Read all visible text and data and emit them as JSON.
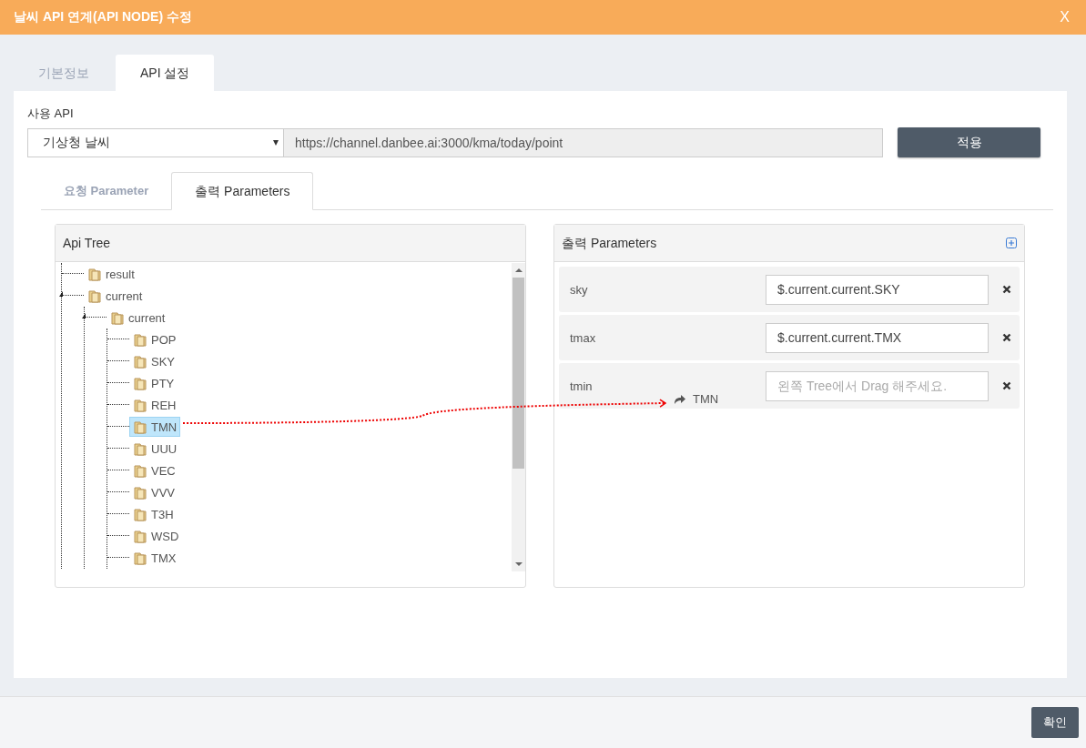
{
  "window": {
    "title": "날씨 API 연계(API NODE) 수정",
    "close": "X"
  },
  "tabs": [
    {
      "label": "기본정보",
      "selected": false
    },
    {
      "label": "API 설정",
      "selected": true
    }
  ],
  "api": {
    "label": "사용 API",
    "select_value": "기상청 날씨",
    "url": "https://channel.danbee.ai:3000/kma/today/point",
    "apply_button": "적용"
  },
  "sub_tabs": [
    {
      "label": "요청 Parameter",
      "selected": false
    },
    {
      "label": "출력 Parameters",
      "selected": true
    }
  ],
  "api_tree": {
    "title": "Api Tree",
    "nodes": [
      {
        "label": "result",
        "selected": false
      },
      {
        "label": "current",
        "selected": false,
        "expanded": true,
        "children": [
          {
            "label": "current",
            "selected": false,
            "expanded": true,
            "children": [
              {
                "label": "POP",
                "selected": false
              },
              {
                "label": "SKY",
                "selected": false
              },
              {
                "label": "PTY",
                "selected": false
              },
              {
                "label": "REH",
                "selected": false
              },
              {
                "label": "TMN",
                "selected": true
              },
              {
                "label": "UUU",
                "selected": false
              },
              {
                "label": "VEC",
                "selected": false
              },
              {
                "label": "VVV",
                "selected": false
              },
              {
                "label": "T3H",
                "selected": false
              },
              {
                "label": "WSD",
                "selected": false
              },
              {
                "label": "TMX",
                "selected": false
              }
            ]
          }
        ]
      }
    ]
  },
  "output_parameters": {
    "title": "출력 Parameters",
    "rows": [
      {
        "name": "sky",
        "value": "$.current.current.SKY"
      },
      {
        "name": "tmax",
        "value": "$.current.current.TMX"
      },
      {
        "name": "tmin",
        "placeholder": "왼쪽 Tree에서 Drag 해주세요."
      }
    ]
  },
  "drag_ghost": {
    "label": "TMN"
  },
  "footer": {
    "confirm_button": "확인"
  }
}
